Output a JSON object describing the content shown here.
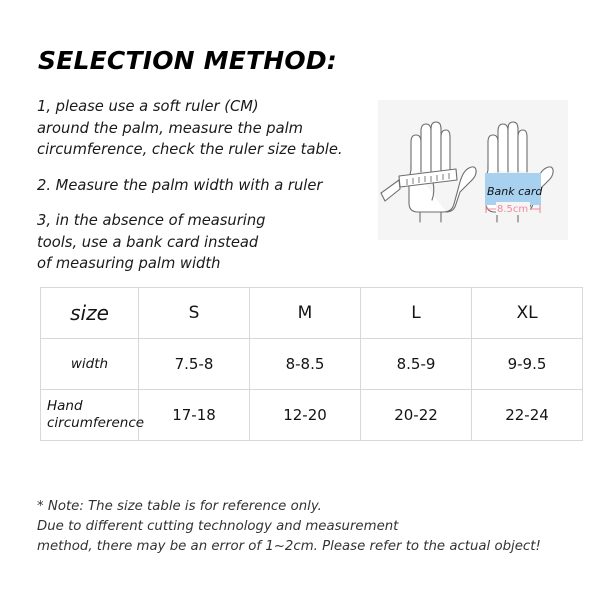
{
  "title": "SELECTION METHOD:",
  "instructions": [
    {
      "id": "instruction-1",
      "lines": [
        "1, please use a soft ruler (CM)",
        "around the palm, measure the palm",
        "circumference, check the ruler size table."
      ]
    },
    {
      "id": "instruction-2",
      "lines": [
        "2. Measure the palm width with a ruler"
      ]
    },
    {
      "id": "instruction-3",
      "lines": [
        "3, in the absence of measuring",
        "tools, use a bank card instead",
        "of measuring palm width"
      ]
    }
  ],
  "illustration": {
    "panel_background": "#f5f5f5",
    "hand_outline_color": "#6e6e6e",
    "left_hand": {
      "label": "ruler-measuring-palm",
      "ruler_fill": "#ffffff",
      "ruler_stroke": "#6e6e6e"
    },
    "right_hand": {
      "label": "bank-card-measuring-palm",
      "card_label": "Bank card",
      "card_color": "#a8d0ef",
      "dimension_label": "8.5cm",
      "dimension_color": "#f4899b"
    }
  },
  "table": {
    "headers": [
      "size",
      "S",
      "M",
      "L",
      "XL"
    ],
    "rows": [
      {
        "label": "width",
        "values": [
          "7.5-8",
          "8-8.5",
          "8.5-9",
          "9-9.5"
        ]
      },
      {
        "label": "Hand circumference",
        "label_line1": "Hand",
        "label_line2": "circumference",
        "values": [
          "17-18",
          "12-20",
          "20-22",
          "22-24"
        ]
      }
    ],
    "border_color": "#d8d8d8"
  },
  "note": {
    "lines": [
      "* Note: The size table is for reference only.",
      "Due to different cutting technology and measurement",
      "method, there may be an error of 1~2cm. Please refer to the actual object!"
    ]
  }
}
